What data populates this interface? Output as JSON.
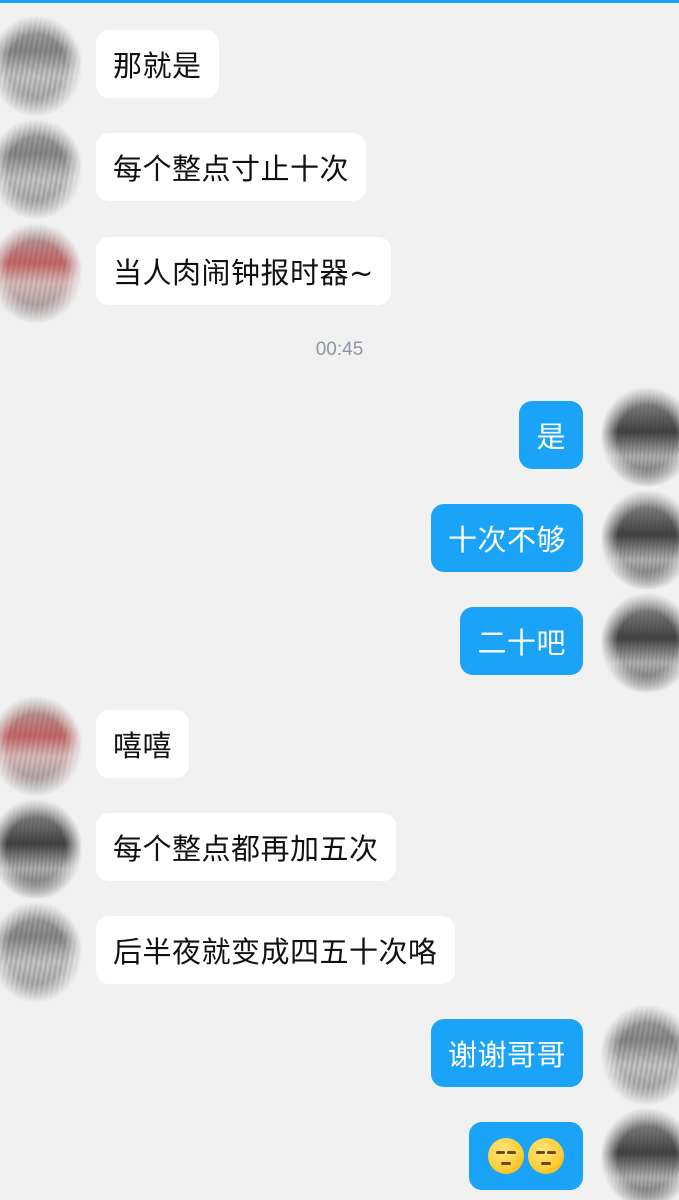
{
  "timestamp": "00:45",
  "messages": [
    {
      "side": "in",
      "text": "那就是"
    },
    {
      "side": "in",
      "text": "每个整点寸止十次"
    },
    {
      "side": "in",
      "text": "当人肉闹钟报时器~"
    },
    {
      "side": "out",
      "text": "是"
    },
    {
      "side": "out",
      "text": "十次不够"
    },
    {
      "side": "out",
      "text": "二十吧"
    },
    {
      "side": "in",
      "text": "嘻嘻"
    },
    {
      "side": "in",
      "text": "每个整点都再加五次"
    },
    {
      "side": "in",
      "text": "后半夜就变成四五十次咯"
    },
    {
      "side": "out",
      "text": "谢谢哥哥"
    },
    {
      "side": "out",
      "emoji": [
        "smirk-face-emoji",
        "smirk-face-emoji"
      ]
    }
  ],
  "colors": {
    "background": "#f1f1f1",
    "incoming_bubble": "#ffffff",
    "outgoing_bubble": "#1aa3f7",
    "timestamp_text": "#8e96a3"
  }
}
